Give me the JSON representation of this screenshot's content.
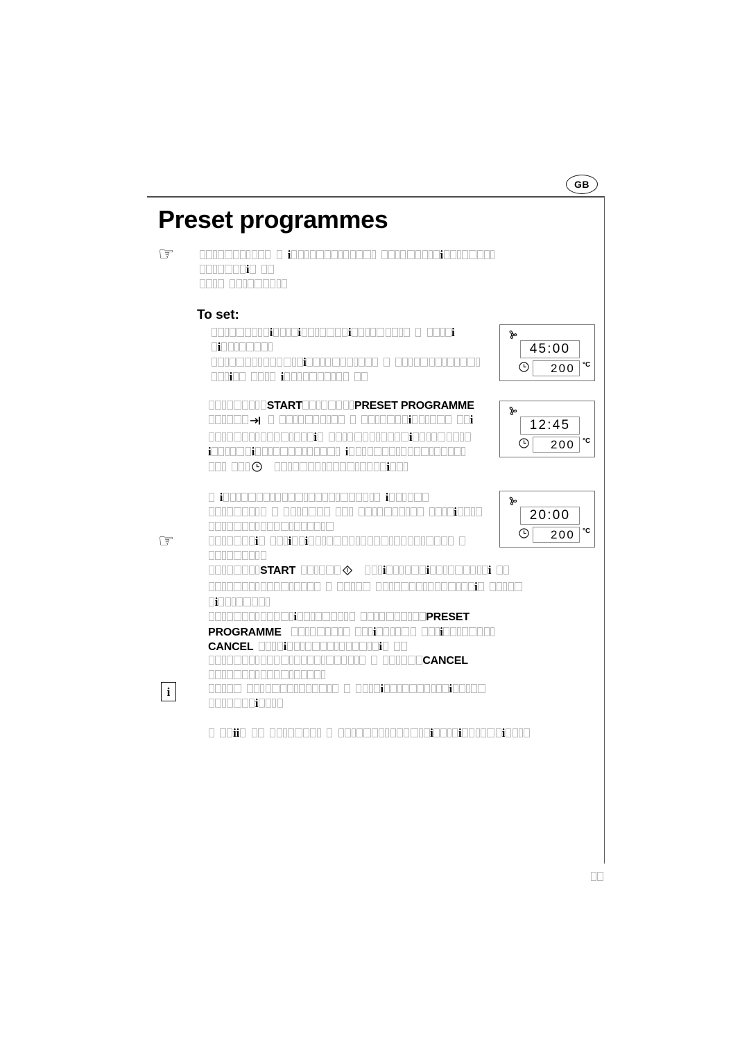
{
  "page": {
    "country_badge": "GB",
    "title": "Preset programmes",
    "subtitle": "To set:",
    "page_number_glyphs": 2
  },
  "keywords": {
    "start": "START",
    "preset_programme": "PRESET  PROGRAMME",
    "preset": "PRESET",
    "programme": "PROGRAMME",
    "cancel": "CANCEL"
  },
  "icons": {
    "hand": "hand-pointer-icon",
    "info": "i",
    "fan": "fan-icon",
    "clock": "clock-icon",
    "arrow_to_bar": "arrow-to-bar-icon",
    "diamond": "diamond-icon"
  },
  "displays": [
    {
      "id": "display-panel-1",
      "time": "45:00",
      "temperature": "200",
      "unit": "°C",
      "fan": "fan-icon",
      "clock": "clock-icon"
    },
    {
      "id": "display-panel-2",
      "time": "12:45",
      "temperature": "200",
      "unit": "°C",
      "fan": "fan-icon",
      "clock": "clock-icon"
    },
    {
      "id": "display-panel-3",
      "time": "20:00",
      "temperature": "200",
      "unit": "°C",
      "fan": "fan-icon",
      "clock": "clock-icon"
    }
  ],
  "body_blocks": [
    {
      "id": "intro-note",
      "marker": "hand-pointer-icon",
      "lines": [
        [
          {
            "t": "tofu",
            "n": 11
          },
          {
            "t": "sp"
          },
          {
            "t": "tofu",
            "n": 1
          },
          {
            "t": "sp"
          },
          {
            "t": "i"
          },
          {
            "t": "tofu",
            "n": 13
          },
          {
            "t": "sp"
          },
          {
            "t": "tofu",
            "n": 9
          },
          {
            "t": "i"
          },
          {
            "t": "tofu",
            "n": 8
          }
        ],
        [
          {
            "t": "tofu",
            "n": 7
          },
          {
            "t": "i"
          },
          {
            "t": "tofu",
            "n": 1
          },
          {
            "t": "sp"
          },
          {
            "t": "tofu",
            "n": 2
          }
        ],
        [
          {
            "t": "tofu",
            "n": 4
          },
          {
            "t": "sp"
          },
          {
            "t": "tofu",
            "n": 9
          }
        ]
      ]
    },
    {
      "id": "set-step-1",
      "lines": [
        [
          {
            "t": "tofu",
            "n": 9
          },
          {
            "t": "i"
          },
          {
            "t": "tofu",
            "n": 4
          },
          {
            "t": "i"
          },
          {
            "t": "tofu",
            "n": 7
          },
          {
            "t": "i"
          },
          {
            "t": "tofu",
            "n": 9
          },
          {
            "t": "sp"
          },
          {
            "t": "tofu",
            "n": 1
          },
          {
            "t": "sp"
          },
          {
            "t": "tofu",
            "n": 4
          },
          {
            "t": "i"
          }
        ],
        [
          {
            "t": "tofu",
            "n": 1
          },
          {
            "t": "i"
          },
          {
            "t": "tofu",
            "n": 8
          }
        ],
        [
          {
            "t": "tofu",
            "n": 14
          },
          {
            "t": "i"
          },
          {
            "t": "tofu",
            "n": 11
          },
          {
            "t": "sp"
          },
          {
            "t": "tofu",
            "n": 1
          },
          {
            "t": "sp"
          },
          {
            "t": "tofu",
            "n": 13
          }
        ],
        [
          {
            "t": "tofu",
            "n": 3
          },
          {
            "t": "i"
          },
          {
            "t": "tofu",
            "n": 2
          },
          {
            "t": "sp"
          },
          {
            "t": "tofu",
            "n": 4
          },
          {
            "t": "sp"
          },
          {
            "t": "i"
          },
          {
            "t": "tofu",
            "n": 10
          },
          {
            "t": "sp"
          },
          {
            "t": "tofu",
            "n": 2
          }
        ]
      ]
    },
    {
      "id": "set-step-2",
      "lines": [
        [
          {
            "t": "tofu",
            "n": 9
          },
          {
            "t": "kw",
            "v": "START"
          },
          {
            "t": "tofu",
            "n": 8
          },
          {
            "t": "kw",
            "v": "PRESET  PROGRAMME"
          }
        ],
        [
          {
            "t": "tofu",
            "n": 6
          },
          {
            "t": "arrow"
          },
          {
            "t": "sp"
          },
          {
            "t": "tofu",
            "n": 1
          },
          {
            "t": "sp"
          },
          {
            "t": "tofu",
            "n": 10
          },
          {
            "t": "sp"
          },
          {
            "t": "tofu",
            "n": 1
          },
          {
            "t": "sp"
          },
          {
            "t": "tofu",
            "n": 7
          },
          {
            "t": "i"
          },
          {
            "t": "tofu",
            "n": 6
          },
          {
            "t": "sp"
          },
          {
            "t": "tofu",
            "n": 2
          },
          {
            "t": "i"
          }
        ],
        [
          {
            "t": "tofu",
            "n": 16
          },
          {
            "t": "i"
          },
          {
            "t": "tofu",
            "n": 1
          },
          {
            "t": "sp"
          },
          {
            "t": "tofu",
            "n": 12
          },
          {
            "t": "i"
          },
          {
            "t": "tofu",
            "n": 9
          }
        ],
        [
          {
            "t": "i"
          },
          {
            "t": "tofu",
            "n": 6
          },
          {
            "t": "i"
          },
          {
            "t": "tofu",
            "n": 13
          },
          {
            "t": "sp"
          },
          {
            "t": "i"
          },
          {
            "t": "tofu",
            "n": 18
          }
        ],
        [
          {
            "t": "tofu",
            "n": 3
          },
          {
            "t": "sp"
          },
          {
            "t": "tofu",
            "n": 3
          },
          {
            "t": "clock"
          },
          {
            "t": "sp"
          },
          {
            "t": "sp"
          },
          {
            "t": "tofu",
            "n": 17
          },
          {
            "t": "i"
          },
          {
            "t": "tofu",
            "n": 3
          }
        ]
      ]
    },
    {
      "id": "set-step-3",
      "marker": "hand-pointer-icon",
      "lines": [
        [
          {
            "t": "tofu",
            "n": 1
          },
          {
            "t": "sp"
          },
          {
            "t": "i"
          },
          {
            "t": "tofu",
            "n": 24
          },
          {
            "t": "sp"
          },
          {
            "t": "i"
          },
          {
            "t": "tofu",
            "n": 6
          }
        ],
        [
          {
            "t": "tofu",
            "n": 9
          },
          {
            "t": "sp"
          },
          {
            "t": "tofu",
            "n": 1
          },
          {
            "t": "sp"
          },
          {
            "t": "tofu",
            "n": 7
          },
          {
            "t": "sp"
          },
          {
            "t": "tofu",
            "n": 3
          },
          {
            "t": "sp"
          },
          {
            "t": "tofu",
            "n": 10
          },
          {
            "t": "sp"
          },
          {
            "t": "tofu",
            "n": 4
          },
          {
            "t": "i"
          },
          {
            "t": "tofu",
            "n": 4
          }
        ],
        [
          {
            "t": "tofu",
            "n": 19
          }
        ],
        [
          {
            "t": "tofu",
            "n": 7
          },
          {
            "t": "i"
          },
          {
            "t": "tofu",
            "n": 1
          },
          {
            "t": "sp"
          },
          {
            "t": "tofu",
            "n": 3
          },
          {
            "t": "i"
          },
          {
            "t": "tofu",
            "n": 2
          },
          {
            "t": "i"
          },
          {
            "t": "tofu",
            "n": 22
          },
          {
            "t": "sp"
          },
          {
            "t": "tofu",
            "n": 1
          }
        ],
        [
          {
            "t": "tofu",
            "n": 9
          }
        ],
        [
          {
            "t": "tofu",
            "n": 8
          },
          {
            "t": "kw",
            "v": "START"
          },
          {
            "t": "sp"
          },
          {
            "t": "tofu",
            "n": 6
          },
          {
            "t": "diamond"
          },
          {
            "t": "sp"
          },
          {
            "t": "sp"
          },
          {
            "t": "tofu",
            "n": 3
          },
          {
            "t": "i"
          },
          {
            "t": "tofu",
            "n": 6
          },
          {
            "t": "i"
          },
          {
            "t": "tofu",
            "n": 9
          },
          {
            "t": "i"
          },
          {
            "t": "sp"
          },
          {
            "t": "tofu",
            "n": 2
          }
        ],
        [
          {
            "t": "tofu",
            "n": 17
          },
          {
            "t": "sp"
          },
          {
            "t": "tofu",
            "n": 1
          },
          {
            "t": "sp"
          },
          {
            "t": "tofu",
            "n": 5
          },
          {
            "t": "sp"
          },
          {
            "t": "tofu",
            "n": 15
          },
          {
            "t": "i"
          },
          {
            "t": "tofu",
            "n": 1
          },
          {
            "t": "sp"
          },
          {
            "t": "tofu",
            "n": 5
          }
        ],
        [
          {
            "t": "tofu",
            "n": 1
          },
          {
            "t": "i"
          },
          {
            "t": "tofu",
            "n": 8
          }
        ],
        [
          {
            "t": "tofu",
            "n": 13
          },
          {
            "t": "i"
          },
          {
            "t": "tofu",
            "n": 9
          },
          {
            "t": "sp"
          },
          {
            "t": "tofu",
            "n": 10
          },
          {
            "t": "kw",
            "v": "PRESET"
          }
        ],
        [
          {
            "t": "kwfirst",
            "v": "PROGRAMME"
          },
          {
            "t": "sp"
          },
          {
            "t": "sp"
          },
          {
            "t": "tofu",
            "n": 9
          },
          {
            "t": "sp"
          },
          {
            "t": "tofu",
            "n": 3
          },
          {
            "t": "i"
          },
          {
            "t": "tofu",
            "n": 6
          },
          {
            "t": "sp"
          },
          {
            "t": "tofu",
            "n": 3
          },
          {
            "t": "i"
          },
          {
            "t": "tofu",
            "n": 8
          }
        ],
        [
          {
            "t": "kwfirst",
            "v": "CANCEL"
          },
          {
            "t": "sp"
          },
          {
            "t": "tofu",
            "n": 4
          },
          {
            "t": "i"
          },
          {
            "t": "tofu",
            "n": 14
          },
          {
            "t": "i"
          },
          {
            "t": "tofu",
            "n": 1
          },
          {
            "t": "sp"
          },
          {
            "t": "tofu",
            "n": 2
          }
        ],
        [
          {
            "t": "tofu",
            "n": 24
          },
          {
            "t": "sp"
          },
          {
            "t": "tofu",
            "n": 1
          },
          {
            "t": "sp"
          },
          {
            "t": "tofu",
            "n": 6
          },
          {
            "t": "kw",
            "v": "CANCEL"
          }
        ],
        [
          {
            "t": "tofu",
            "n": 18
          }
        ]
      ]
    },
    {
      "id": "info-note",
      "marker": "info-box-icon",
      "lines": [
        [
          {
            "t": "tofu",
            "n": 5
          },
          {
            "t": "sp"
          },
          {
            "t": "tofu",
            "n": 14
          },
          {
            "t": "sp"
          },
          {
            "t": "tofu",
            "n": 1
          },
          {
            "t": "sp"
          },
          {
            "t": "tofu",
            "n": 4
          },
          {
            "t": "i"
          },
          {
            "t": "tofu",
            "n": 10
          },
          {
            "t": "i"
          },
          {
            "t": "tofu",
            "n": 5
          }
        ],
        [
          {
            "t": "tofu",
            "n": 7
          },
          {
            "t": "i"
          },
          {
            "t": "tofu",
            "n": 4
          }
        ]
      ]
    },
    {
      "id": "closing-note",
      "lines": [
        [
          {
            "t": "tofu",
            "n": 1
          },
          {
            "t": "sp"
          },
          {
            "t": "tofu",
            "n": 2
          },
          {
            "t": "i"
          },
          {
            "t": "i"
          },
          {
            "t": "tofu",
            "n": 1
          },
          {
            "t": "sp"
          },
          {
            "t": "tofu",
            "n": 2
          },
          {
            "t": "sp"
          },
          {
            "t": "tofu",
            "n": 8
          },
          {
            "t": "sp"
          },
          {
            "t": "tofu",
            "n": 1
          },
          {
            "t": "sp"
          },
          {
            "t": "tofu",
            "n": 14
          },
          {
            "t": "i"
          },
          {
            "t": "tofu",
            "n": 4
          },
          {
            "t": "i"
          },
          {
            "t": "tofu",
            "n": 6
          },
          {
            "t": "i"
          },
          {
            "t": "tofu",
            "n": 4
          }
        ]
      ]
    }
  ]
}
